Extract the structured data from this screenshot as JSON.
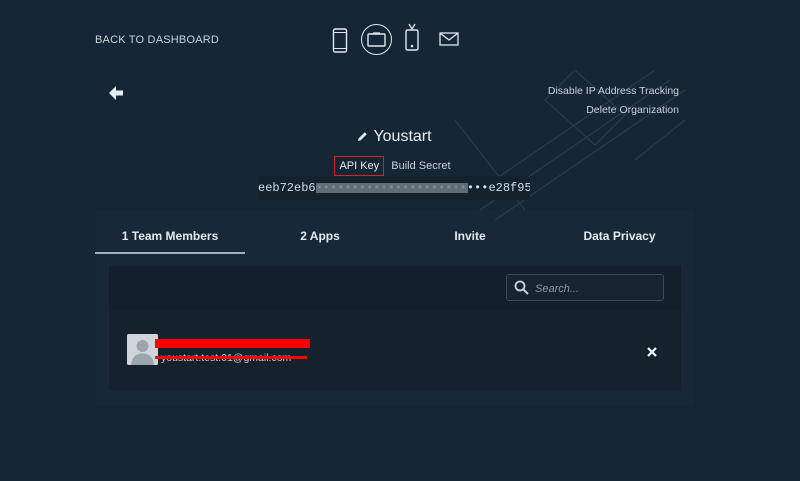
{
  "nav": {
    "back_label": "BACK TO DASHBOARD"
  },
  "devices": {
    "icons": [
      "phone-icon",
      "tablet-icon",
      "tv-icon",
      "mail-icon"
    ],
    "selected": "tablet-icon"
  },
  "org": {
    "name": "Youstart",
    "options": {
      "disable_ip": "Disable IP Address Tracking",
      "delete_org": "Delete Organization"
    },
    "key_tabs": [
      "API Key",
      "Build Secret"
    ],
    "active_key_tab": "API Key",
    "key_value": "eeb72eb6••••••••••••••••••••••••e28f9597"
  },
  "tabs": [
    "1 Team Members",
    "2 Apps",
    "Invite",
    "Data Privacy"
  ],
  "active_tab": "1 Team Members",
  "search": {
    "placeholder": "Search...",
    "value": ""
  },
  "members": [
    {
      "name": "",
      "email": "youstart.test.01@gmail.com"
    }
  ],
  "colors": {
    "background": "#162634",
    "panel": "#182838",
    "highlight": "#d61f26"
  }
}
